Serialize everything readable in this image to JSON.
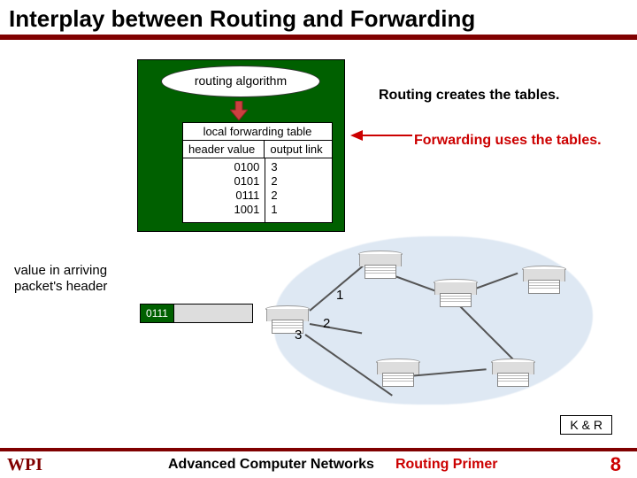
{
  "title": "Interplay between Routing and Forwarding",
  "algorithm_label": "routing algorithm",
  "table": {
    "caption": "local forwarding table",
    "header_col1": "header value",
    "header_col2": "output link",
    "rows": [
      {
        "hv": "0100",
        "ol": "3"
      },
      {
        "hv": "0101",
        "ol": "2"
      },
      {
        "hv": "0111",
        "ol": "2"
      },
      {
        "hv": "1001",
        "ol": "1"
      }
    ]
  },
  "note_routing": "Routing creates the tables.",
  "note_forwarding": "Forwarding uses the tables.",
  "value_label_line1": "value in arriving",
  "value_label_line2": "packet's header",
  "packet_header": "0111",
  "ports": {
    "p1": "1",
    "p2": "2",
    "p3": "3"
  },
  "kr": "K & R",
  "footer": {
    "logo_main": "WPI",
    "course": "Advanced Computer Networks",
    "topic": "Routing  Primer",
    "page": "8"
  }
}
